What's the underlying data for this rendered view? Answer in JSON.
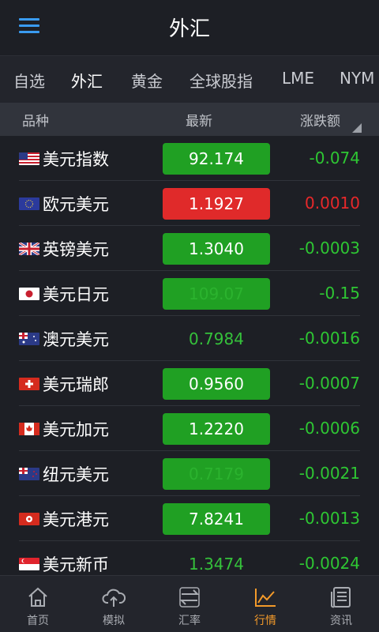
{
  "header": {
    "title": "外汇",
    "menu_icon": "hamburger-menu-icon"
  },
  "tabs": [
    {
      "label": "自选",
      "active": false
    },
    {
      "label": "外汇",
      "active": true
    },
    {
      "label": "黄金",
      "active": false
    },
    {
      "label": "全球股指",
      "active": false
    },
    {
      "label": "LME",
      "active": false
    },
    {
      "label": "NYM",
      "active": false
    }
  ],
  "columns": {
    "name": "品种",
    "latest": "最新",
    "change": "涨跌额"
  },
  "rows": [
    {
      "name": "美元指数",
      "flag": "us-flag-icon",
      "price": "92.174",
      "price_style": "green",
      "change": "-0.074",
      "direction": "down"
    },
    {
      "name": "欧元美元",
      "flag": "eu-flag-icon",
      "price": "1.1927",
      "price_style": "red",
      "change": "0.0010",
      "direction": "up"
    },
    {
      "name": "英镑美元",
      "flag": "uk-flag-icon",
      "price": "1.3040",
      "price_style": "green",
      "change": "-0.0003",
      "direction": "down"
    },
    {
      "name": "美元日元",
      "flag": "japan-flag-icon",
      "price": "109.07",
      "price_style": "faint",
      "change": "-0.15",
      "direction": "down"
    },
    {
      "name": "澳元美元",
      "flag": "australia-flag-icon",
      "price": "0.7984",
      "price_style": "plain",
      "change": "-0.0016",
      "direction": "down"
    },
    {
      "name": "美元瑞郎",
      "flag": "switzerland-flag-icon",
      "price": "0.9560",
      "price_style": "green",
      "change": "-0.0007",
      "direction": "down"
    },
    {
      "name": "美元加元",
      "flag": "canada-flag-icon",
      "price": "1.2220",
      "price_style": "green",
      "change": "-0.0006",
      "direction": "down"
    },
    {
      "name": "纽元美元",
      "flag": "new-zealand-flag-icon",
      "price": "0.7179",
      "price_style": "faint",
      "change": "-0.0021",
      "direction": "down"
    },
    {
      "name": "美元港元",
      "flag": "hong-kong-flag-icon",
      "price": "7.8241",
      "price_style": "green",
      "change": "-0.0013",
      "direction": "down"
    },
    {
      "name": "美元新币",
      "flag": "singapore-flag-icon",
      "price": "1.3474",
      "price_style": "plain",
      "change": "-0.0024",
      "direction": "down"
    }
  ],
  "bottom_nav": [
    {
      "label": "首页",
      "icon": "home-icon",
      "active": false
    },
    {
      "label": "模拟",
      "icon": "cloud-upload-icon",
      "active": false
    },
    {
      "label": "汇率",
      "icon": "exchange-icon",
      "active": false
    },
    {
      "label": "行情",
      "icon": "chart-line-icon",
      "active": true
    },
    {
      "label": "资讯",
      "icon": "news-icon",
      "active": false
    }
  ],
  "colors": {
    "up": "#e8282a",
    "down": "#2ec733",
    "accent": "#f39a2a",
    "menu": "#3a9bf0"
  }
}
